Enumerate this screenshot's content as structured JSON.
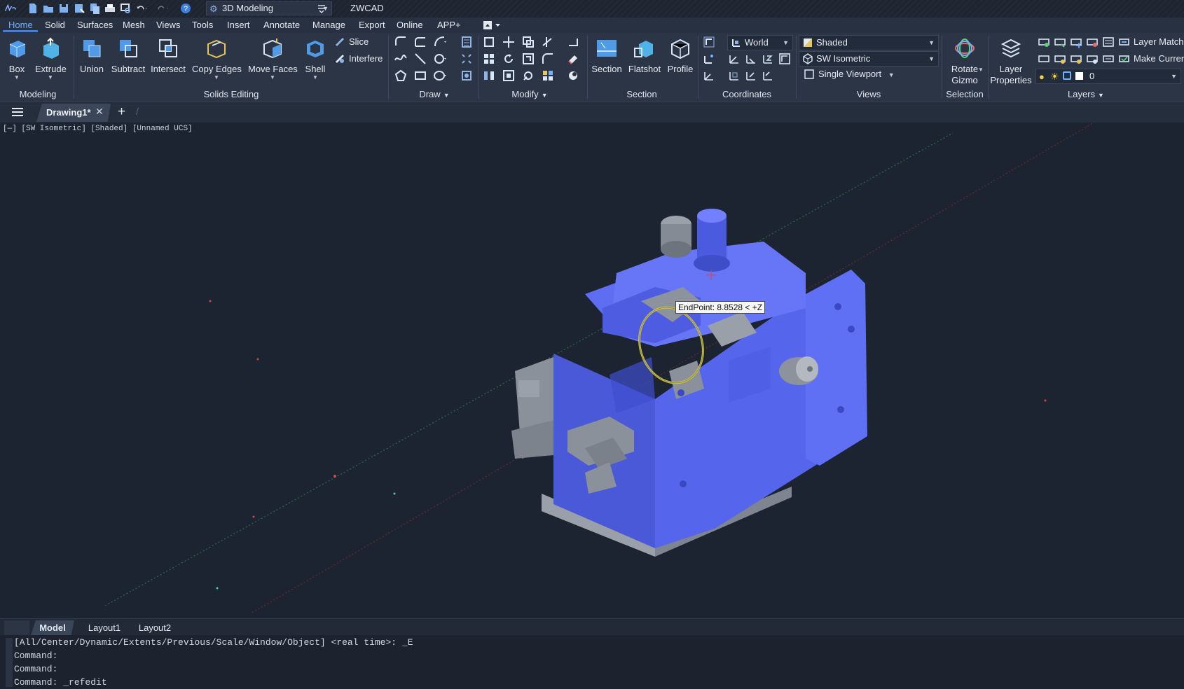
{
  "titlebar": {
    "workspace": "3D Modeling",
    "app_title": "ZWCAD"
  },
  "menu": {
    "items": [
      "Home",
      "Solid",
      "Surfaces",
      "Mesh",
      "Views",
      "Tools",
      "Insert",
      "Annotate",
      "Manage",
      "Export",
      "Online",
      "APP+"
    ],
    "active": "Home"
  },
  "ribbon": {
    "modeling": {
      "label": "Modeling",
      "box": "Box",
      "extrude": "Extrude"
    },
    "solids_editing": {
      "label": "Solids Editing",
      "union": "Union",
      "subtract": "Subtract",
      "intersect": "Intersect",
      "copy_edges": "Copy Edges",
      "move_faces": "Move Faces",
      "shell": "Shell",
      "slice": "Slice",
      "interfere": "Interfere"
    },
    "draw": {
      "label": "Draw"
    },
    "modify": {
      "label": "Modify"
    },
    "section": {
      "label": "Section",
      "section": "Section",
      "flatshot": "Flatshot",
      "profile": "Profile"
    },
    "coordinates": {
      "label": "Coordinates",
      "ucs": "World"
    },
    "views": {
      "label": "Views",
      "visual_style": "Shaded",
      "view": "SW Isometric",
      "viewport": "Single Viewport"
    },
    "selection": {
      "label": "Selection",
      "rotate_gizmo_1": "Rotate",
      "rotate_gizmo_2": "Gizmo"
    },
    "layers": {
      "label": "Layers",
      "layer_props_1": "Layer",
      "layer_props_2": "Properties",
      "layer_match": "Layer Match",
      "make_current": "Make Current",
      "current_layer": "0"
    }
  },
  "tabs": {
    "document": "Drawing1*"
  },
  "viewport": {
    "label": "[—] [SW Isometric] [Shaded] [Unnamed UCS]",
    "tooltip": "EndPoint: 8.8528 < +Z",
    "model_color": "#5a6af0",
    "background": "#1c2431"
  },
  "layout_tabs": [
    "Model",
    "Layout1",
    "Layout2"
  ],
  "command": {
    "lines": [
      "[All/Center/Dynamic/Extents/Previous/Scale/Window/Object] <real time>: _E",
      "Command:",
      "Command:",
      "Command: _refedit"
    ]
  },
  "colors": {
    "accent": "#3c7fe0",
    "ribbon_bg": "#2b3546",
    "menu_active": "#6fb1ff"
  }
}
